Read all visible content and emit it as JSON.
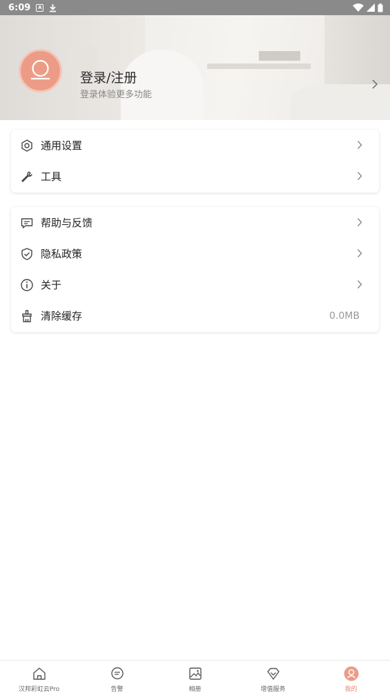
{
  "status_bar": {
    "time": "6:09"
  },
  "header": {
    "login_title": "登录/注册",
    "login_subtitle": "登录体验更多功能"
  },
  "menu_group_1": [
    {
      "label": "通用设置",
      "icon": "settings-hexagon-icon",
      "chevron": true
    },
    {
      "label": "工具",
      "icon": "wrench-icon",
      "chevron": true
    }
  ],
  "menu_group_2": [
    {
      "label": "帮助与反馈",
      "icon": "message-icon",
      "chevron": true
    },
    {
      "label": "隐私政策",
      "icon": "shield-icon",
      "chevron": true
    },
    {
      "label": "关于",
      "icon": "info-icon",
      "chevron": true
    },
    {
      "label": "清除缓存",
      "icon": "broom-icon",
      "value": "0.0MB"
    }
  ],
  "tabbar": {
    "tabs": [
      {
        "label": "汉邦彩虹云Pro",
        "icon": "home-icon"
      },
      {
        "label": "告警",
        "icon": "alarm-message-icon"
      },
      {
        "label": "相册",
        "icon": "album-icon"
      },
      {
        "label": "增值服务",
        "icon": "diamond-icon"
      },
      {
        "label": "我的",
        "icon": "profile-icon",
        "active": true
      }
    ]
  },
  "colors": {
    "accent": "#e8886e",
    "avatar": "#ec9c86",
    "status_bar": "#8a8a8a"
  }
}
